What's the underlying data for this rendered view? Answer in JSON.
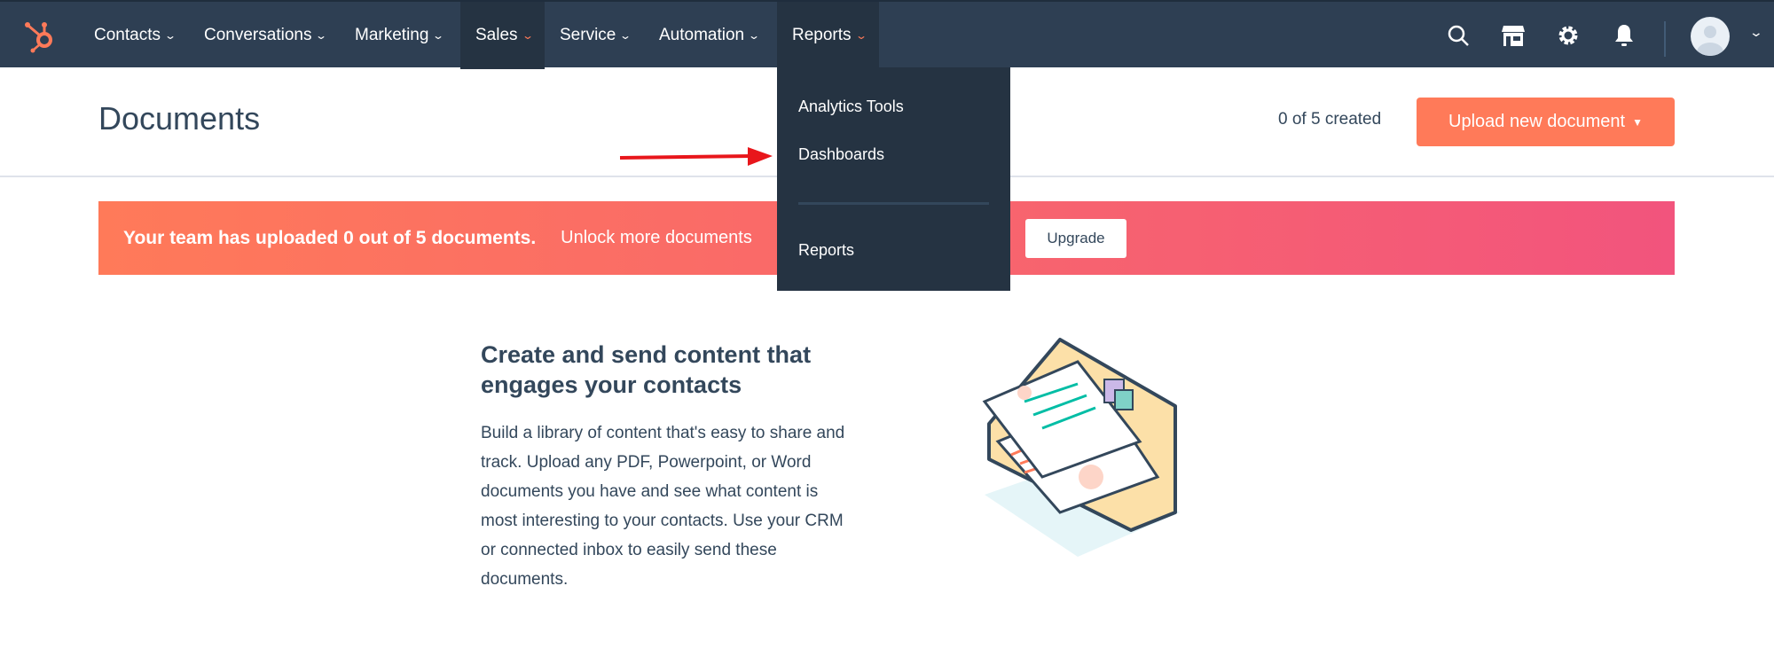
{
  "nav": {
    "logo": "hubspot-sprocket-logo",
    "items": [
      {
        "label": "Contacts",
        "active": false
      },
      {
        "label": "Conversations",
        "active": false
      },
      {
        "label": "Marketing",
        "active": false
      },
      {
        "label": "Sales",
        "active": true
      },
      {
        "label": "Service",
        "active": false
      },
      {
        "label": "Automation",
        "active": false
      },
      {
        "label": "Reports",
        "active": true
      }
    ],
    "icons": [
      "search-icon",
      "marketplace-icon",
      "settings-icon",
      "notifications-icon",
      "avatar",
      "chevron-down-icon"
    ],
    "chevron": "⌄"
  },
  "page": {
    "title": "Documents",
    "created_count": "0 of 5 created",
    "upload_button": "Upload new document"
  },
  "banner": {
    "bold_text": "Your team has uploaded 0 out of 5 documents.",
    "text": "Unlock more documents",
    "upgrade_button": "Upgrade"
  },
  "reports_menu": {
    "items": [
      "Analytics Tools",
      "Dashboards",
      "Reports"
    ]
  },
  "empty_state": {
    "heading": "Create and send content that engages your contacts",
    "body": "Build a library of content that's easy to share and track. Upload any PDF, Powerpoint, or Word documents you have and see what content is most interesting to your contacts. Use your CRM or connected inbox to easily send these documents."
  },
  "colors": {
    "nav": "#2e3f53",
    "accent": "#ff7a59",
    "banner_end": "#f2547d",
    "arrow": "#e8161b"
  }
}
